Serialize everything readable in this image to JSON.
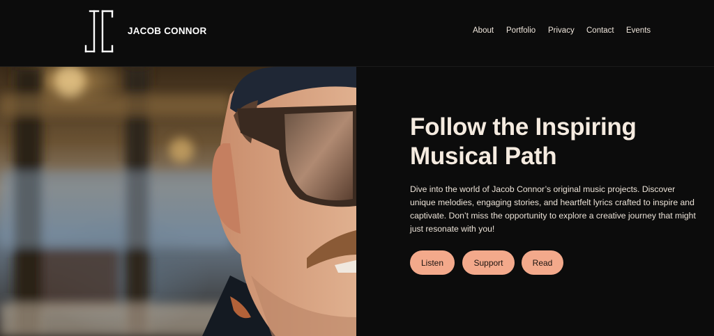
{
  "header": {
    "brand": "JACOB CONNOR",
    "nav": [
      "About",
      "Portfolio",
      "Privacy",
      "Contact",
      "Events"
    ]
  },
  "hero": {
    "title_line1": "Follow the Inspiring",
    "title_line2": "Musical Path",
    "description": "Dive into the world of Jacob Connor’s original music projects. Discover unique melodies, engaging stories, and heartfelt lyrics crafted to inspire and captivate. Don’t miss the opportunity to explore a creative journey that might just resonate with you!",
    "buttons": [
      "Listen",
      "Support",
      "Read"
    ]
  },
  "colors": {
    "background": "#0c0c0c",
    "accent": "#f3a98b",
    "text": "#f5ebe0"
  }
}
